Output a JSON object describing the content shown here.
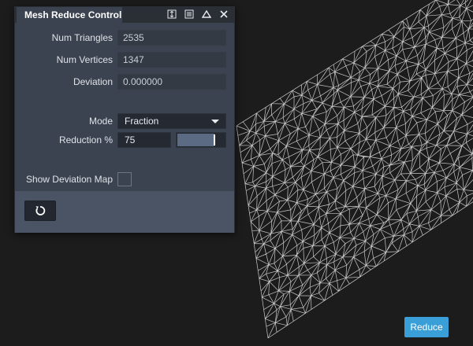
{
  "panel": {
    "title": "Mesh Reduce Control",
    "icons": [
      "pin-icon",
      "menu-icon",
      "collapse-icon",
      "close-icon"
    ],
    "stats": [
      {
        "label": "Num Triangles",
        "value": "2535"
      },
      {
        "label": "Num Vertices",
        "value": "1347"
      },
      {
        "label": "Deviation",
        "value": "0.000000"
      }
    ],
    "mode": {
      "label": "Mode",
      "value": "Fraction"
    },
    "reduction": {
      "label": "Reduction %",
      "value": "75",
      "slider_fraction": 0.75
    },
    "deviation_map": {
      "label": "Show Deviation Map",
      "checked": false
    },
    "reset_icon": "reset-icon"
  },
  "viewport": {
    "reduce_button": "Reduce"
  },
  "colors": {
    "accent": "#3a9fd6",
    "panel_bg": "#3c4350",
    "viewport_bg": "#1c1c1c",
    "wireframe": "#e8e8e8"
  }
}
